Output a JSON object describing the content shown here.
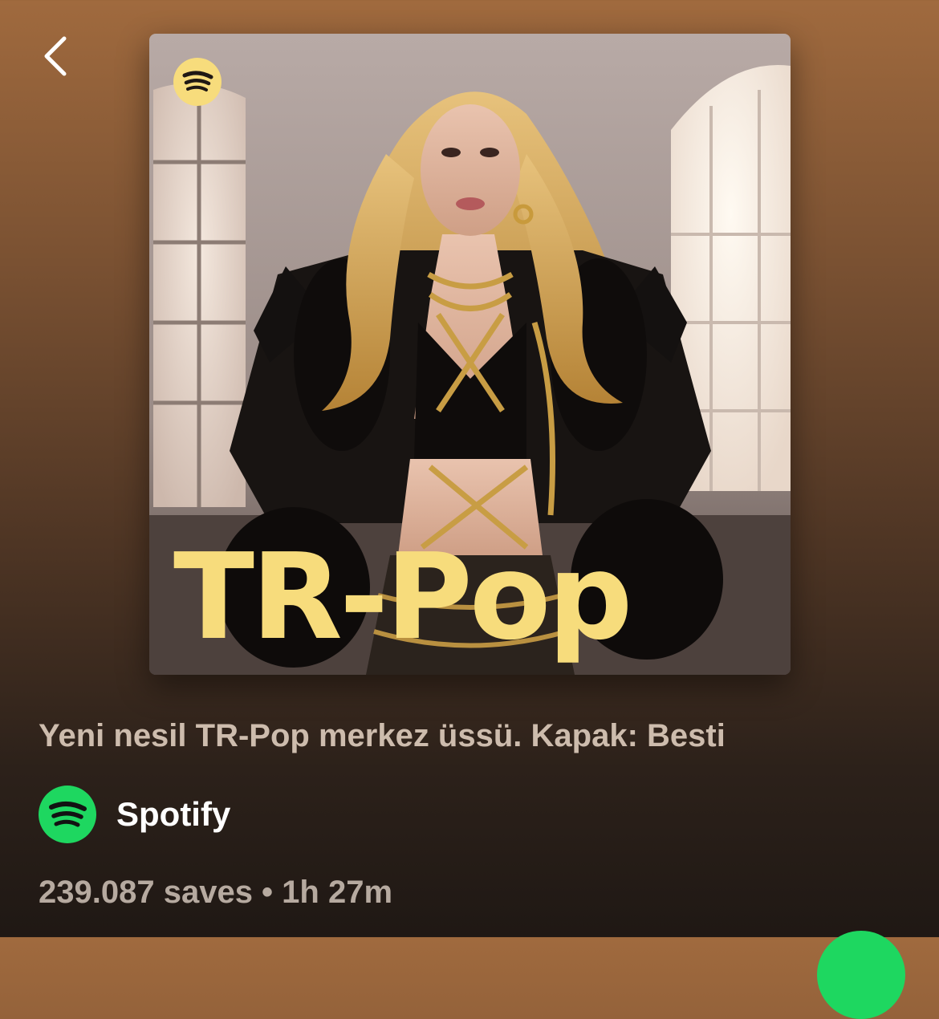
{
  "header": {
    "back_icon": "chevron-left-icon"
  },
  "cover": {
    "title": "TR-Pop",
    "logo_icon": "spotify-logo-icon",
    "title_color": "#f7dc7c",
    "logo_color": "#f7dc7c"
  },
  "playlist": {
    "description": "Yeni nesil TR-Pop merkez üssü. Kapak: Besti",
    "owner": {
      "name": "Spotify",
      "logo_icon": "spotify-logo-icon",
      "logo_color": "#1ed760"
    },
    "meta": "239.087 saves • 1h 27m"
  },
  "controls": {
    "play_icon": "play-button-icon",
    "play_color": "#1ed760"
  }
}
